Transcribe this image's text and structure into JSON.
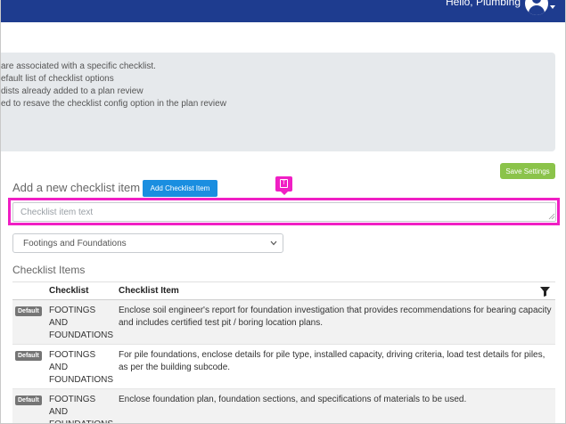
{
  "header": {
    "greeting": "Hello, Plumbing"
  },
  "info": {
    "lines": [
      "are associated with a specific checklist.",
      "efault list of checklist options",
      "dists already added to a plan review",
      "ed to resave the checklist config option in the plan review"
    ]
  },
  "actions": {
    "save_settings": "Save Settings",
    "add_checklist_item": "Add Checklist Item"
  },
  "form": {
    "section_title": "Add a new checklist item",
    "item_placeholder": "Checklist item text",
    "item_value": "",
    "checklist_select": "Footings and Foundations"
  },
  "list": {
    "title": "Checklist Items",
    "columns": {
      "checklist": "Checklist",
      "item": "Checklist Item"
    },
    "rows": [
      {
        "badge": "Default",
        "checklist": "FOOTINGS AND FOUNDATIONS",
        "item": "Enclose soil engineer's report for foundation investigation that provides recommendations for bearing capacity and includes certified test pit / boring location plans."
      },
      {
        "badge": "Default",
        "checklist": "FOOTINGS AND FOUNDATIONS",
        "item": "For pile foundations, enclose details for pile type, installed capacity, driving criteria, load test details for piles, as per the building subcode."
      },
      {
        "badge": "Default",
        "checklist": "FOOTINGS AND FOUNDATIONS",
        "item": "Enclose foundation plan, foundation sections, and specifications of materials to be used."
      }
    ]
  },
  "icons": {
    "avatar": "user-avatar-icon",
    "filter": "filter-icon",
    "marker": "text-field-marker-icon"
  },
  "colors": {
    "topbar": "#1e3c8f",
    "primary_button": "#1a8ee0",
    "success_button": "#8bc34a",
    "highlight": "#f01fc4",
    "badge": "#757575"
  }
}
